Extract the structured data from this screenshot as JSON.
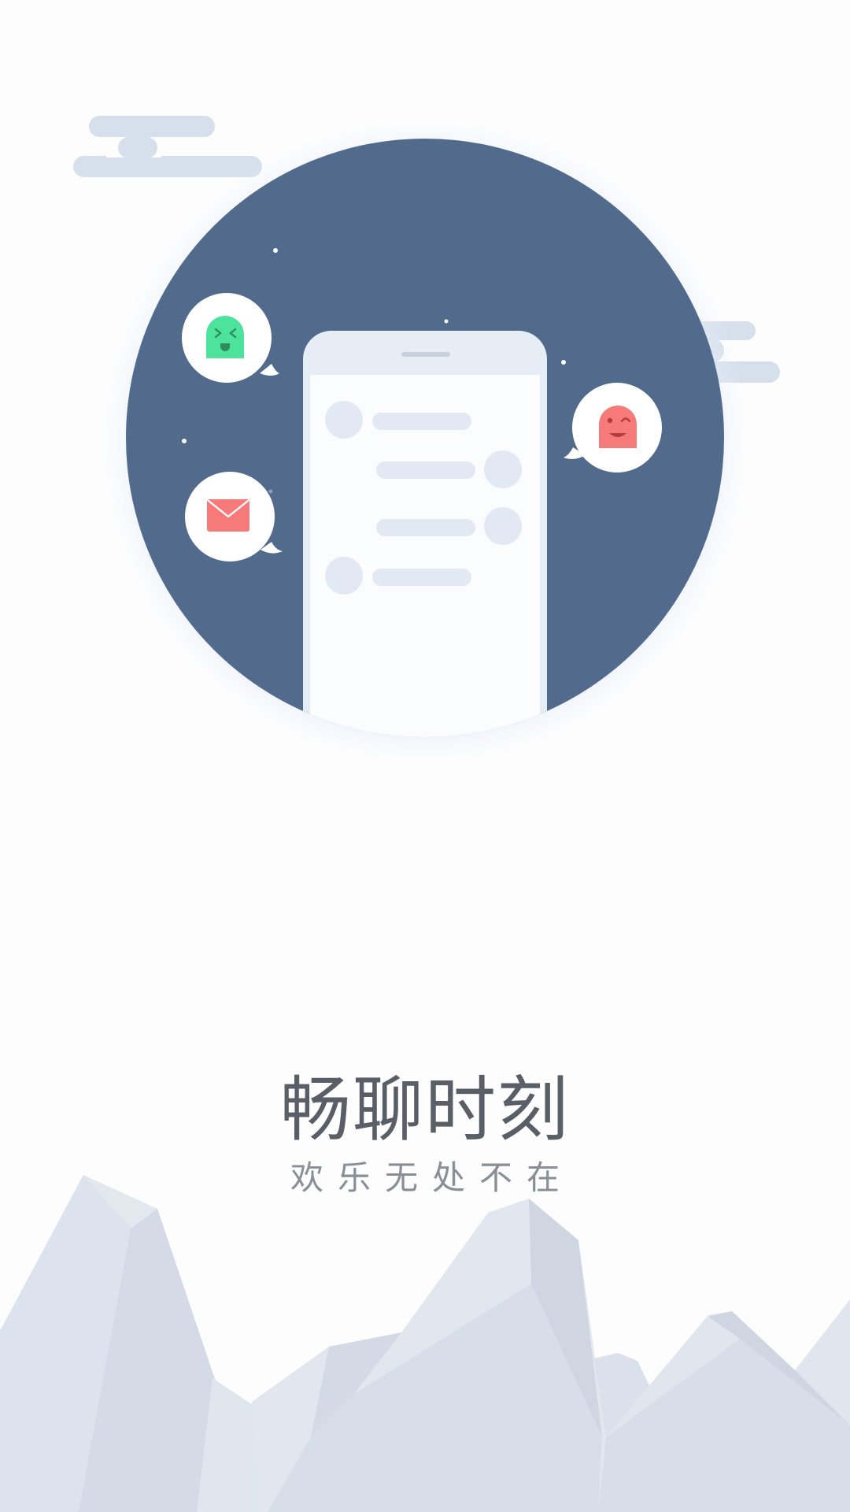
{
  "splash": {
    "title": "畅聊时刻",
    "subtitle": "欢乐无处不在"
  },
  "illustration": {
    "icons": [
      "chat-phone-icon",
      "green-ghost-icon",
      "red-ghost-icon",
      "mail-icon"
    ],
    "colors": {
      "circle": "#526b8c",
      "cloud": "#d5e0ec",
      "phone_frame": "#e6edf5",
      "chat_bubble": "#e2e9f2",
      "green_ghost": "#4ee39c",
      "red_ghost": "#f77a7a",
      "mountain": "#d9dfe8"
    }
  }
}
